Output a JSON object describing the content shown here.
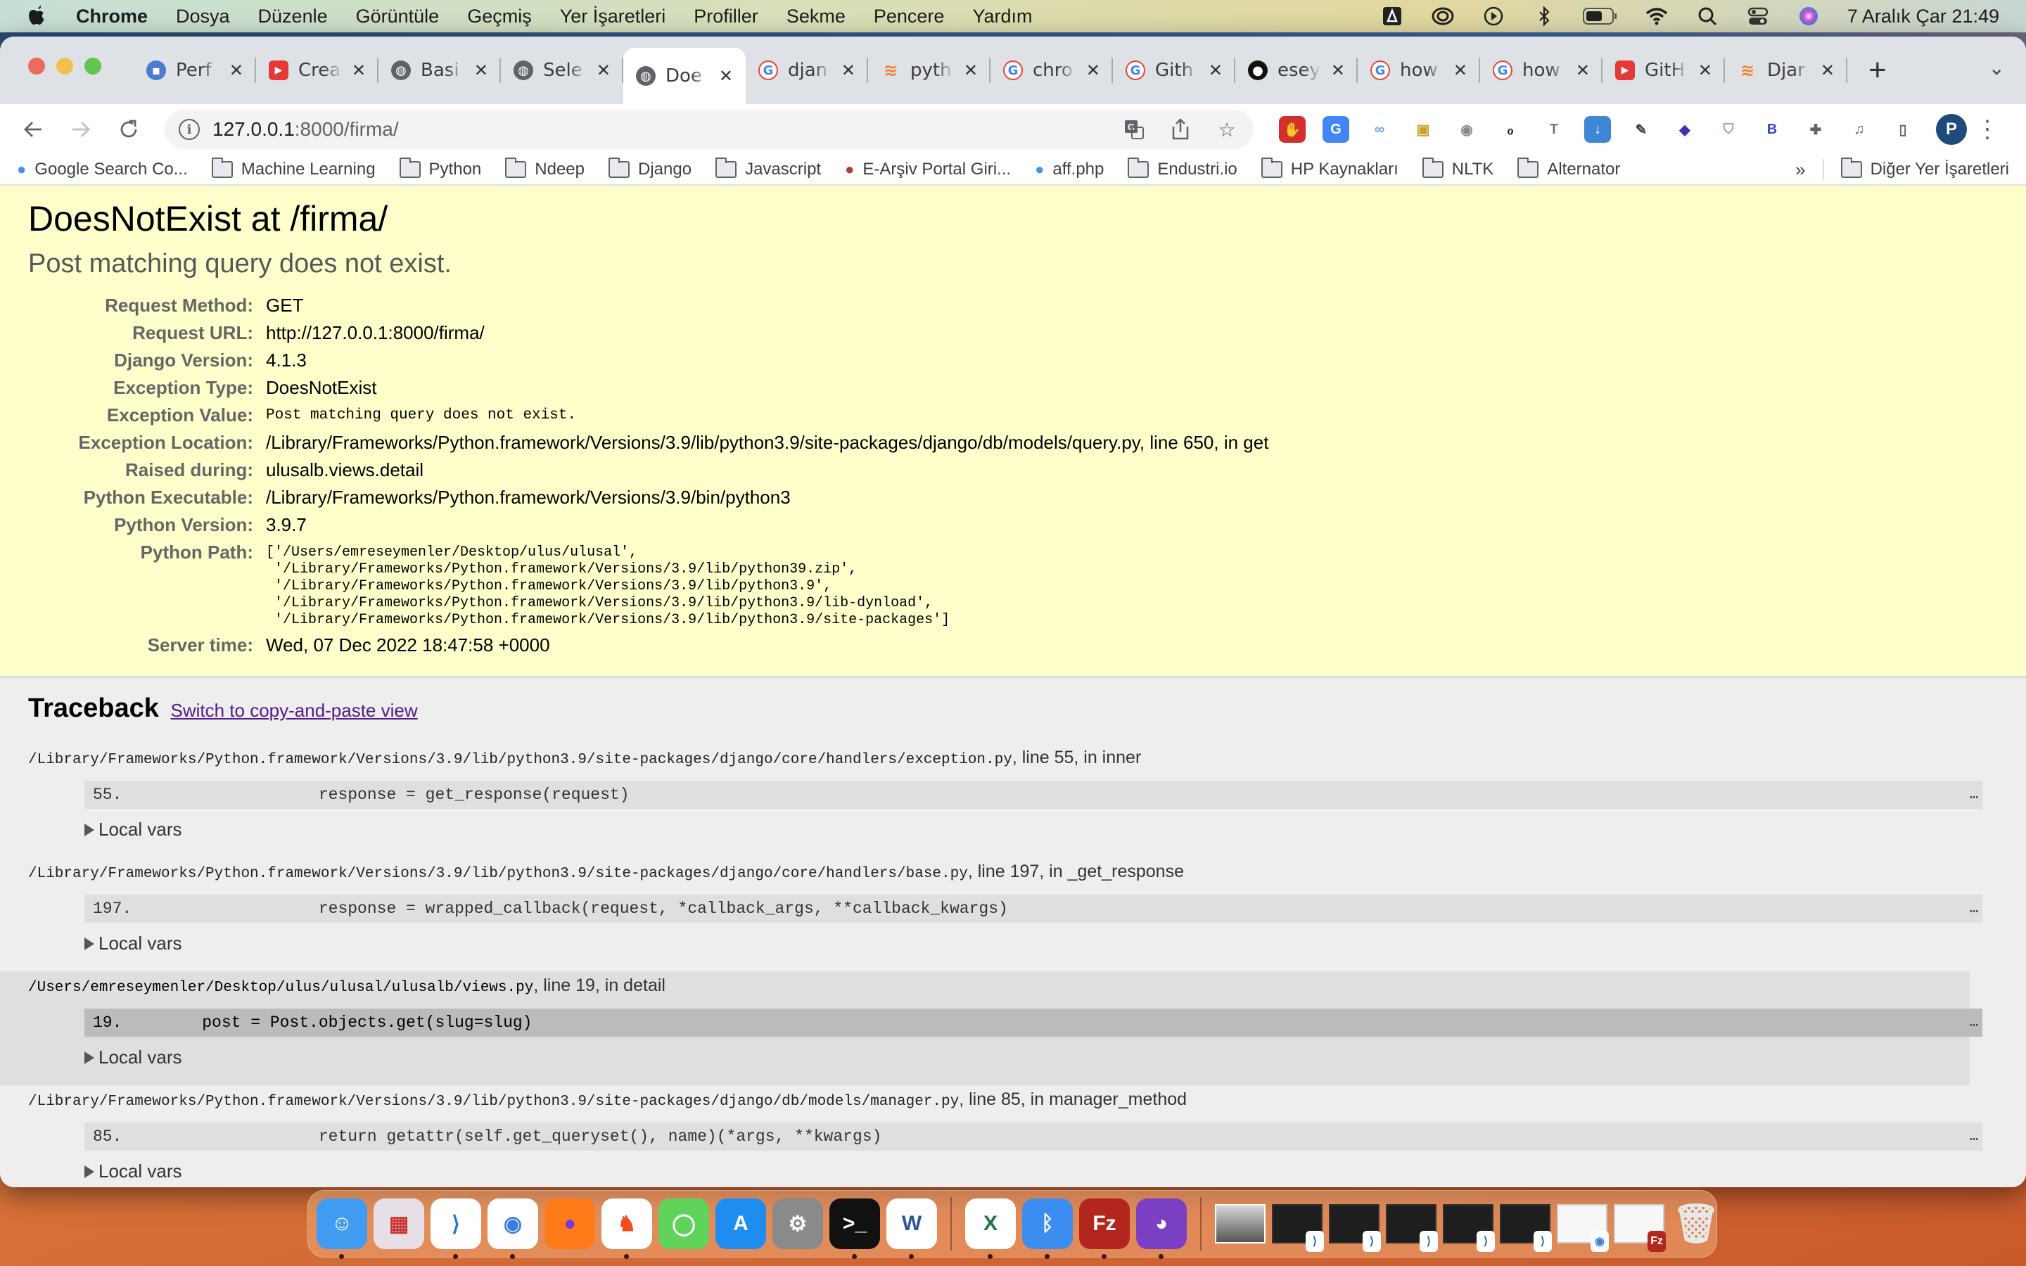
{
  "menubar": {
    "app_name": "Chrome",
    "items": [
      "Dosya",
      "Düzenle",
      "Görüntüle",
      "Geçmiş",
      "Yer İşaretleri",
      "Profiller",
      "Sekme",
      "Pencere",
      "Yardım"
    ],
    "status_icons": [
      "dropzone-icon",
      "creative-cloud-icon",
      "play-icon",
      "bluetooth-icon",
      "battery-icon",
      "wifi-icon",
      "spotlight-search-icon",
      "control-center-icon",
      "siri-icon"
    ],
    "clock": "7 Aralık Çar  21:49"
  },
  "tabs": [
    {
      "title": "Perf",
      "icon": "search-console-icon",
      "color": "#4a7bd0",
      "active": false
    },
    {
      "title": "Crea",
      "icon": "youtube-icon",
      "color": "#e53935",
      "active": false
    },
    {
      "title": "Basi",
      "icon": "globe-icon",
      "color": "#5f6368",
      "active": false
    },
    {
      "title": "Sele",
      "icon": "globe-icon",
      "color": "#5f6368",
      "active": false
    },
    {
      "title": "Doe",
      "icon": "globe-icon",
      "color": "#5f6368",
      "active": true
    },
    {
      "title": "djan",
      "icon": "google-icon",
      "color": "#4285f4",
      "active": false
    },
    {
      "title": "pyth",
      "icon": "stackoverflow-icon",
      "color": "#f48024",
      "active": false
    },
    {
      "title": "chro",
      "icon": "google-icon",
      "color": "#4285f4",
      "active": false
    },
    {
      "title": "Gith",
      "icon": "google-icon",
      "color": "#4285f4",
      "active": false
    },
    {
      "title": "esey",
      "icon": "github-icon",
      "color": "#111111",
      "active": false
    },
    {
      "title": "how",
      "icon": "google-icon",
      "color": "#4285f4",
      "active": false
    },
    {
      "title": "how",
      "icon": "google-icon",
      "color": "#4285f4",
      "active": false
    },
    {
      "title": "GitH",
      "icon": "youtube-icon",
      "color": "#e53935",
      "active": false
    },
    {
      "title": "Djar",
      "icon": "stackoverflow-icon",
      "color": "#f48024",
      "active": false
    }
  ],
  "toolbar": {
    "url_host": "127.0.0.1",
    "url_path": ":8000/firma/",
    "extensions": [
      {
        "name": "adblock-icon",
        "glyph": "✋",
        "bg": "#d32f2f",
        "fg": "#ffffff"
      },
      {
        "name": "google-translate-ext-icon",
        "glyph": "G",
        "bg": "#4285f4",
        "fg": "#ffffff"
      },
      {
        "name": "link-icon",
        "glyph": "∞",
        "bg": "#ffffff",
        "fg": "#6f9fd8"
      },
      {
        "name": "image-downloader-icon",
        "glyph": "▣",
        "bg": "#ffffff",
        "fg": "#c9a227"
      },
      {
        "name": "camera-icon",
        "glyph": "◉",
        "bg": "#ffffff",
        "fg": "#888888"
      },
      {
        "name": "ocr-paper-icon",
        "glyph": "ℴ",
        "bg": "#ffffff",
        "fg": "#222222"
      },
      {
        "name": "text-icon",
        "glyph": "T",
        "bg": "#ffffff",
        "fg": "#777777"
      },
      {
        "name": "download-icon",
        "glyph": "↓",
        "bg": "#3f86d6",
        "fg": "#ffffff"
      },
      {
        "name": "eyedropper-icon",
        "glyph": "✎",
        "bg": "#ffffff",
        "fg": "#444444"
      },
      {
        "name": "layers-icon",
        "glyph": "◆",
        "bg": "#ffffff",
        "fg": "#4a2bb0"
      },
      {
        "name": "shield-icon",
        "glyph": "⛉",
        "bg": "#ffffff",
        "fg": "#8aa0bf"
      },
      {
        "name": "b-extension-icon",
        "glyph": "B",
        "bg": "#ffffff",
        "fg": "#3c4ac0"
      },
      {
        "name": "puzzle-icon",
        "glyph": "✚",
        "bg": "#ffffff",
        "fg": "#5f6368"
      },
      {
        "name": "media-icon",
        "glyph": "♫",
        "bg": "#ffffff",
        "fg": "#5f6368"
      },
      {
        "name": "sidepanel-icon",
        "glyph": "▯",
        "bg": "#ffffff",
        "fg": "#5f6368"
      }
    ],
    "profile_initial": "P"
  },
  "bookmarks": [
    {
      "label": "Google Search Co...",
      "type": "site"
    },
    {
      "label": "Machine Learning",
      "type": "folder"
    },
    {
      "label": "Python",
      "type": "folder"
    },
    {
      "label": "Ndeep",
      "type": "folder"
    },
    {
      "label": "Django",
      "type": "folder"
    },
    {
      "label": "Javascript",
      "type": "folder"
    },
    {
      "label": "E-Arşiv Portal Giri...",
      "type": "site"
    },
    {
      "label": "aff.php",
      "type": "site"
    },
    {
      "label": "Endustri.io",
      "type": "folder"
    },
    {
      "label": "HP Kaynakları",
      "type": "folder"
    },
    {
      "label": "NLTK",
      "type": "folder"
    },
    {
      "label": "Alternator",
      "type": "folder"
    }
  ],
  "bookmarks_more": "»",
  "bookmarks_other": "Diğer Yer İşaretleri",
  "error": {
    "title": "DoesNotExist at /firma/",
    "exception_value": "Post matching query does not exist.",
    "meta": [
      {
        "label": "Request Method:",
        "value": "GET",
        "style": "text"
      },
      {
        "label": "Request URL:",
        "value": "http://127.0.0.1:8000/firma/",
        "style": "text"
      },
      {
        "label": "Django Version:",
        "value": "4.1.3",
        "style": "text"
      },
      {
        "label": "Exception Type:",
        "value": "DoesNotExist",
        "style": "text"
      },
      {
        "label": "Exception Value:",
        "value": "Post matching query does not exist.",
        "style": "mono"
      },
      {
        "label": "Exception Location:",
        "value": "/Library/Frameworks/Python.framework/Versions/3.9/lib/python3.9/site-packages/django/db/models/query.py, line 650, in get",
        "style": "text"
      },
      {
        "label": "Raised during:",
        "value": "ulusalb.views.detail",
        "style": "text"
      },
      {
        "label": "Python Executable:",
        "value": "/Library/Frameworks/Python.framework/Versions/3.9/bin/python3",
        "style": "text"
      },
      {
        "label": "Python Version:",
        "value": "3.9.7",
        "style": "text"
      },
      {
        "label": "Python Path:",
        "value": "['/Users/emreseymenler/Desktop/ulus/ulusal',\n '/Library/Frameworks/Python.framework/Versions/3.9/lib/python39.zip',\n '/Library/Frameworks/Python.framework/Versions/3.9/lib/python3.9',\n '/Library/Frameworks/Python.framework/Versions/3.9/lib/python3.9/lib-dynload',\n '/Library/Frameworks/Python.framework/Versions/3.9/lib/python3.9/site-packages']",
        "style": "pre"
      },
      {
        "label": "Server time:",
        "value": "Wed, 07 Dec 2022 18:47:58 +0000",
        "style": "text"
      }
    ]
  },
  "traceback": {
    "heading": "Traceback",
    "switch_link": "Switch to copy-and-paste view",
    "local_vars_label": "Local vars",
    "more_label": "…",
    "frames": [
      {
        "file": "/Library/Frameworks/Python.framework/Versions/3.9/lib/python3.9/site-packages/django/core/handlers/exception.py",
        "suffix": ", line 55, in inner",
        "lineno": "55.",
        "code": "                response = get_response(request)",
        "user": false
      },
      {
        "file": "/Library/Frameworks/Python.framework/Versions/3.9/lib/python3.9/site-packages/django/core/handlers/base.py",
        "suffix": ", line 197, in _get_response",
        "lineno": "197.",
        "code": "                response = wrapped_callback(request, *callback_args, **callback_kwargs)",
        "user": false
      },
      {
        "file": "/Users/emreseymenler/Desktop/ulus/ulusal/ulusalb/views.py",
        "suffix": ", line 19, in detail",
        "lineno": "19.",
        "code": "    post = Post.objects.get(slug=slug)",
        "user": true
      },
      {
        "file": "/Library/Frameworks/Python.framework/Versions/3.9/lib/python3.9/site-packages/django/db/models/manager.py",
        "suffix": ", line 85, in manager_method",
        "lineno": "85.",
        "code": "                return getattr(self.get_queryset(), name)(*args, **kwargs)",
        "user": false
      }
    ]
  },
  "dock": {
    "apps": [
      {
        "name": "finder",
        "glyph": "☺",
        "bg": "#3f9cf0",
        "running": true
      },
      {
        "name": "launchpad",
        "glyph": "▦",
        "bg": "#e6e0e6",
        "fg": "#c33",
        "running": false
      },
      {
        "name": "vscode",
        "glyph": "⟩",
        "bg": "#ffffff",
        "fg": "#1f78d1",
        "running": true
      },
      {
        "name": "chrome",
        "glyph": "◉",
        "bg": "#ffffff",
        "fg": "#3b7ddd",
        "running": true
      },
      {
        "name": "firefox",
        "glyph": "●",
        "bg": "#ff7b1a",
        "fg": "#7a3cd0",
        "running": false
      },
      {
        "name": "brave",
        "glyph": "♞",
        "bg": "#ffffff",
        "fg": "#f04a1d",
        "running": true
      },
      {
        "name": "messages",
        "glyph": "◯",
        "bg": "#5fd35a",
        "running": false
      },
      {
        "name": "app-store",
        "glyph": "A",
        "bg": "#1f8df0",
        "running": false
      },
      {
        "name": "system-preferences",
        "glyph": "⚙",
        "bg": "#8a8a8a",
        "running": false
      },
      {
        "name": "terminal",
        "glyph": ">_",
        "bg": "#111111",
        "running": true
      },
      {
        "name": "word",
        "glyph": "W",
        "bg": "#ffffff",
        "fg": "#2b579a",
        "running": true
      }
    ],
    "apps2": [
      {
        "name": "excel",
        "glyph": "X",
        "bg": "#ffffff",
        "fg": "#217346",
        "running": true
      },
      {
        "name": "bluetooth-file-exchange",
        "glyph": "ᛒ",
        "bg": "#3b8ef0",
        "running": true
      },
      {
        "name": "filezilla",
        "glyph": "Fz",
        "bg": "#b3261e",
        "running": true
      },
      {
        "name": "github-desktop",
        "glyph": "◕",
        "bg": "#7b3fc4",
        "running": true
      }
    ],
    "minimized": [
      {
        "name": "preview-photo",
        "kind": "photo",
        "badge": ""
      },
      {
        "name": "vscode-window-1",
        "kind": "dark",
        "badge": "⟩"
      },
      {
        "name": "vscode-window-2",
        "kind": "dark",
        "badge": "⟩"
      },
      {
        "name": "vscode-window-3",
        "kind": "dark",
        "badge": "⟩"
      },
      {
        "name": "vscode-window-4",
        "kind": "dark",
        "badge": "⟩"
      },
      {
        "name": "vscode-window-5",
        "kind": "dark",
        "badge": "⟩"
      },
      {
        "name": "chrome-window",
        "kind": "light",
        "badge": "◉"
      },
      {
        "name": "filezilla-window",
        "kind": "light",
        "badge": "Fz"
      }
    ],
    "trash": "trash-icon"
  }
}
